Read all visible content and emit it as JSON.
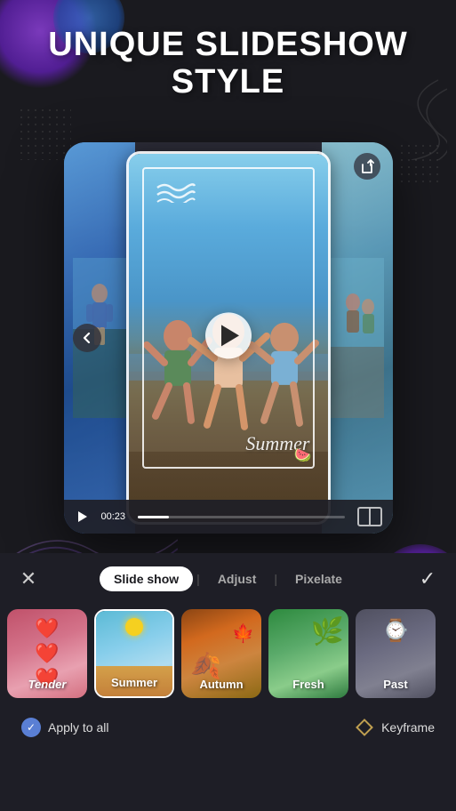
{
  "header": {
    "line1": "UNIQUE SLIDESHOW",
    "line2": "STYLE"
  },
  "preview": {
    "time": "00:23",
    "summer_text": "Summer",
    "nav_left_label": "‹",
    "nav_right_label": "›",
    "share_icon": "share-icon",
    "compare_icon": "compare-icon"
  },
  "tabs": {
    "close_label": "✕",
    "items": [
      {
        "id": "slideshow",
        "label": "Slide show",
        "active": true
      },
      {
        "id": "adjust",
        "label": "Adjust",
        "active": false
      },
      {
        "id": "pixelate",
        "label": "Pixelate",
        "active": false
      }
    ],
    "confirm_label": "✓"
  },
  "filters": [
    {
      "id": "tender",
      "label": "Tender",
      "selected": false,
      "theme": "tender"
    },
    {
      "id": "summer",
      "label": "Summer",
      "selected": true,
      "theme": "summer"
    },
    {
      "id": "autumn",
      "label": "Autumn",
      "selected": false,
      "theme": "autumn"
    },
    {
      "id": "fresh",
      "label": "Fresh",
      "selected": false,
      "theme": "fresh"
    },
    {
      "id": "past",
      "label": "Past",
      "selected": false,
      "theme": "past"
    }
  ],
  "actions": {
    "apply_all_label": "Apply to all",
    "keyframe_label": "Keyframe"
  }
}
